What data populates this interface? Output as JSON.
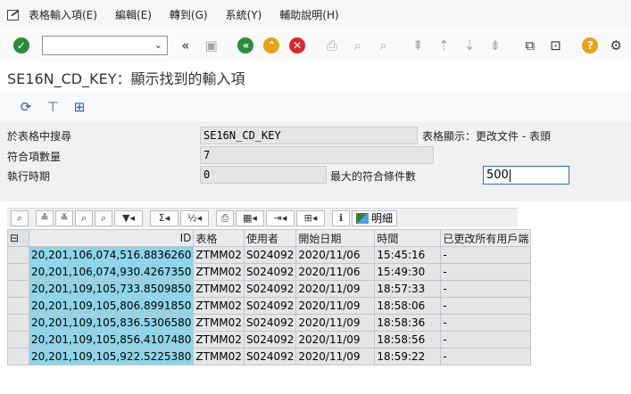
{
  "menu": {
    "items": [
      "表格輸入項(E)",
      "編輯(E)",
      "轉到(G)",
      "系統(Y)",
      "輔助說明(H)"
    ]
  },
  "toolbar": {
    "command_value": "",
    "icons": [
      "check-icon",
      "back-icon",
      "save-icon",
      "nav-back-icon",
      "nav-up-icon",
      "cancel-icon",
      "print-icon",
      "find-icon",
      "find-next-icon",
      "first-page-icon",
      "prev-page-icon",
      "next-page-icon",
      "last-page-icon",
      "new-session-icon",
      "shortcut-icon",
      "help-icon",
      "settings-icon"
    ]
  },
  "title": "SE16N_CD_KEY：顯示找到的輸入項",
  "form": {
    "search_label": "於表格中搜尋",
    "search_value": "SE16N_CD_KEY",
    "table_hint": "表格顯示：更改文件 - 表頭",
    "count_label": "符合項數量",
    "count_value": "7",
    "runtime_label": "執行時期",
    "runtime_value": "0",
    "max_label": "最大的符合條件數",
    "max_value": "500"
  },
  "alv": {
    "detail_label": "明細"
  },
  "table": {
    "headers": [
      "ID",
      "表格",
      "使用者",
      "開始日期",
      "時間",
      "已更改所有用戶端"
    ],
    "rows": [
      [
        "20,201,106,074,516.8836260",
        "ZTMM02",
        "S024092",
        "2020/11/06",
        "15:45:16",
        "-"
      ],
      [
        "20,201,106,074,930.4267350",
        "ZTMM02",
        "S024092",
        "2020/11/06",
        "15:49:30",
        "-"
      ],
      [
        "20,201,109,105,733.8509850",
        "ZTMM02",
        "S024092",
        "2020/11/09",
        "18:57:33",
        "-"
      ],
      [
        "20,201,109,105,806.8991850",
        "ZTMM02",
        "S024092",
        "2020/11/09",
        "18:58:06",
        "-"
      ],
      [
        "20,201,109,105,836.5306580",
        "ZTMM02",
        "S024092",
        "2020/11/09",
        "18:58:36",
        "-"
      ],
      [
        "20,201,109,105,856.4107480",
        "ZTMM02",
        "S024092",
        "2020/11/09",
        "18:58:56",
        "-"
      ],
      [
        "20,201,109,105,922.5225380",
        "ZTMM02",
        "S024092",
        "2020/11/09",
        "18:59:22",
        "-"
      ]
    ]
  },
  "colors": {
    "key_column": "#8fd4e8",
    "confirm_green": "#2c8a3b",
    "cancel_red": "#d8282f",
    "nav_orange": "#e6a319"
  }
}
